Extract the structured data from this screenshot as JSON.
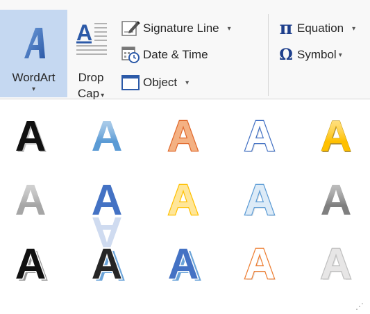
{
  "ribbon": {
    "wordart": {
      "label": "WordArt",
      "arrow": "▾",
      "selected": true
    },
    "dropcap": {
      "label_line1": "Drop",
      "label_line2": "Cap",
      "arrow": "▾"
    },
    "signature_line": {
      "label": "Signature Line",
      "arrow": "▾",
      "icon": "signature-line-icon"
    },
    "date_time": {
      "label": "Date & Time",
      "icon": "date-time-icon"
    },
    "object": {
      "label": "Object",
      "arrow": "▾",
      "icon": "object-icon"
    },
    "equation": {
      "label": "Equation",
      "arrow": "▾",
      "icon": "pi-icon"
    },
    "symbol": {
      "label": "Symbol",
      "arrow": "▾",
      "icon": "omega-icon"
    }
  },
  "gallery": {
    "letter": "A",
    "rows": [
      [
        {
          "name": "wordart-style-1",
          "fill": "#111111",
          "stroke": "none",
          "effect": "shadow"
        },
        {
          "name": "wordart-style-2",
          "fill": "#5b9bd5",
          "stroke": "none",
          "effect": "gradient"
        },
        {
          "name": "wordart-style-3",
          "fill": "#f4b183",
          "stroke": "#e0682b",
          "effect": "outline-fill"
        },
        {
          "name": "wordart-style-4",
          "fill": "#ffffff",
          "stroke": "#4472c4",
          "effect": "outline"
        },
        {
          "name": "wordart-style-5",
          "fill": "#ffc000",
          "stroke": "#bf8f00",
          "effect": "gold"
        }
      ],
      [
        {
          "name": "wordart-style-6",
          "fill": "#a6a6a6",
          "stroke": "none",
          "effect": "gradient"
        },
        {
          "name": "wordart-style-7",
          "fill": "#4472c4",
          "stroke": "none",
          "effect": "reflection"
        },
        {
          "name": "wordart-style-8",
          "fill": "#ffe699",
          "stroke": "#ffc000",
          "effect": "outline-fill"
        },
        {
          "name": "wordart-style-9",
          "fill": "#ddebf7",
          "stroke": "#5b9bd5",
          "effect": "outline"
        },
        {
          "name": "wordart-style-10",
          "fill": "#7f7f7f",
          "stroke": "none",
          "effect": "gradient"
        }
      ],
      [
        {
          "name": "wordart-style-11",
          "fill": "#111111",
          "stroke": "#ffffff",
          "effect": "outline-shadow"
        },
        {
          "name": "wordart-style-12",
          "fill": "#262626",
          "stroke": "#ffffff",
          "effect": "blue-shadow"
        },
        {
          "name": "wordart-style-13",
          "fill": "#4472c4",
          "stroke": "#ffffff",
          "effect": "blue-shadow"
        },
        {
          "name": "wordart-style-14",
          "fill": "#ffffff",
          "stroke": "#ed7d31",
          "effect": "outline"
        },
        {
          "name": "wordart-style-15",
          "fill": "#e7e6e6",
          "stroke": "#bfbfbf",
          "effect": "outline"
        }
      ]
    ],
    "resize_grip": "⋰"
  }
}
